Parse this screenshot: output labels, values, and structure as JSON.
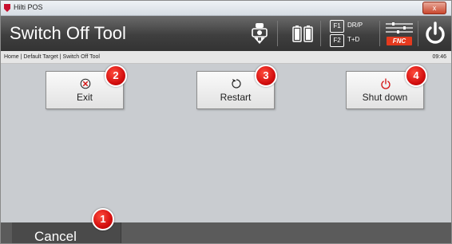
{
  "window": {
    "title": "Hilti POS",
    "close_label": "x"
  },
  "header": {
    "title": "Switch Off Tool",
    "f1_key": "F1",
    "f1_label": "DR/P",
    "f2_key": "F2",
    "f2_label": "T+D",
    "fnc_label": "FNC",
    "icons": [
      "target-icon",
      "battery-icon",
      "f-keys-icon",
      "fnc-menu-icon",
      "power-icon"
    ]
  },
  "breadcrumb": {
    "path": "Home | Default Target | Switch Off Tool",
    "time": "09:46"
  },
  "buttons": {
    "exit": {
      "label": "Exit",
      "icon": "close-circle-icon",
      "marker": "2"
    },
    "restart": {
      "label": "Restart",
      "icon": "restart-icon",
      "marker": "3"
    },
    "shutdown": {
      "label": "Shut down",
      "icon": "power-icon",
      "marker": "4"
    }
  },
  "footer": {
    "cancel_label": "Cancel",
    "marker": "1"
  },
  "colors": {
    "accent_red": "#d40f0f",
    "header_dark": "#3f3f3f",
    "fnc_red": "#e53a1e"
  }
}
